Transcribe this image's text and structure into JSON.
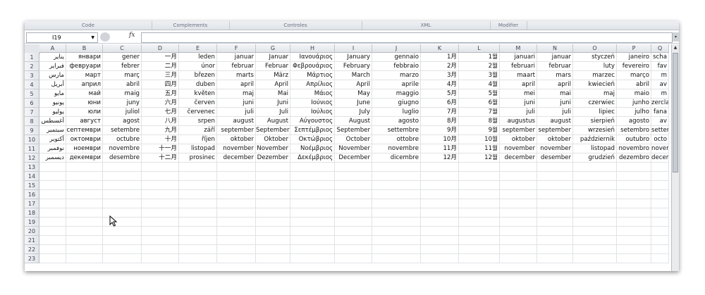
{
  "ribbon": {
    "groups": [
      "Code",
      "Complements",
      "Controles",
      "XML",
      "Modifier"
    ]
  },
  "formula_bar": {
    "name_box": "I19",
    "fx_label": "fx",
    "formula": ""
  },
  "columns": [
    "A",
    "B",
    "C",
    "D",
    "E",
    "F",
    "G",
    "H",
    "I",
    "J",
    "K",
    "L",
    "M",
    "N",
    "O",
    "P",
    "Q"
  ],
  "rows": [
    [
      "يناير",
      "январи",
      "gener",
      "一月",
      "leden",
      "januar",
      "Januar",
      "Ιανουάριος",
      "January",
      "gennaio",
      "1月",
      "1월",
      "januari",
      "januar",
      "styczeń",
      "janeiro",
      "scha"
    ],
    [
      "فبراير",
      "февруари",
      "febrer",
      "二月",
      "únor",
      "februar",
      "Februar",
      "Φεβρουάριος",
      "February",
      "febbraio",
      "2月",
      "2월",
      "februari",
      "februar",
      "luty",
      "fevereiro",
      "fav"
    ],
    [
      "مارس",
      "март",
      "març",
      "三月",
      "březen",
      "marts",
      "März",
      "Μάρτιος",
      "March",
      "marzo",
      "3月",
      "3월",
      "maart",
      "mars",
      "marzec",
      "março",
      "m"
    ],
    [
      "أبريل",
      "април",
      "abril",
      "四月",
      "duben",
      "april",
      "April",
      "Απρίλιος",
      "April",
      "aprile",
      "4月",
      "4월",
      "april",
      "april",
      "kwiecień",
      "abril",
      "av"
    ],
    [
      "مايو",
      "май",
      "maig",
      "五月",
      "květen",
      "maj",
      "Mai",
      "Μάιος",
      "May",
      "maggio",
      "5月",
      "5월",
      "mei",
      "mai",
      "maj",
      "maio",
      "m"
    ],
    [
      "يونيو",
      "юни",
      "juny",
      "六月",
      "červen",
      "juni",
      "Juni",
      "Ιούνιος",
      "June",
      "giugno",
      "6月",
      "6월",
      "juni",
      "juni",
      "czerwiec",
      "junho",
      "zercla"
    ],
    [
      "يوليو",
      "юли",
      "juliol",
      "七月",
      "červenec",
      "juli",
      "Juli",
      "Ιούλιος",
      "July",
      "luglio",
      "7月",
      "7월",
      "juli",
      "juli",
      "lipiec",
      "julho",
      "fana"
    ],
    [
      "أغسطس",
      "август",
      "agost",
      "八月",
      "srpen",
      "august",
      "August",
      "Αύγουστος",
      "August",
      "agosto",
      "8月",
      "8월",
      "augustus",
      "august",
      "sierpień",
      "agosto",
      "av"
    ],
    [
      "سبتمبر",
      "септември",
      "setembre",
      "九月",
      "září",
      "september",
      "September",
      "Σεπτέμβριος",
      "September",
      "settembre",
      "9月",
      "9월",
      "september",
      "september",
      "wrzesień",
      "setembro",
      "settem"
    ],
    [
      "أكتوبر",
      "октомври",
      "octubre",
      "十月",
      "říjen",
      "oktober",
      "Oktober",
      "Οκτώβριος",
      "October",
      "ottobre",
      "10月",
      "10월",
      "oktober",
      "oktober",
      "październik",
      "outubro",
      "octo"
    ],
    [
      "نوفمبر",
      "ноември",
      "novembre",
      "十一月",
      "listopad",
      "november",
      "November",
      "Νοέμβριος",
      "November",
      "novembre",
      "11月",
      "11월",
      "november",
      "november",
      "listopad",
      "novembro",
      "novem"
    ],
    [
      "ديسمبر",
      "декември",
      "desembre",
      "十二月",
      "prosinec",
      "december",
      "Dezember",
      "Δεκέμβριος",
      "December",
      "dicembre",
      "12月",
      "12월",
      "december",
      "desember",
      "grudzień",
      "dezembro",
      "decem"
    ]
  ],
  "row_numbers": [
    "1",
    "2",
    "3",
    "4",
    "5",
    "6",
    "7",
    "8",
    "9",
    "10",
    "11",
    "12",
    "13",
    "14",
    "15",
    "16",
    "17",
    "18",
    "19",
    "20",
    "21",
    "22",
    "23"
  ]
}
